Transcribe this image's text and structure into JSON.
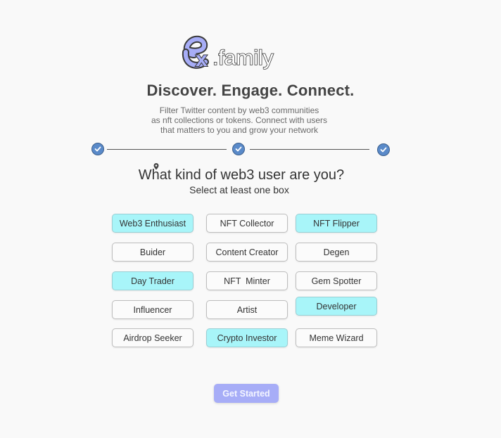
{
  "brand": {
    "logo_text_ex": "ex",
    "logo_text_family": ".family",
    "accent": "#a7adf7"
  },
  "hero": {
    "headline": "Discover. Engage. Connect.",
    "sub_line1": "Filter Twitter content by web3 communities",
    "sub_line2": "as nft collections or tokens. Connect with users",
    "sub_line3": "that matters to you and grow your network"
  },
  "steps": {
    "count": 3,
    "completed": 3,
    "icon": "check-icon",
    "color": "#5a8ac9"
  },
  "question": {
    "title": "What kind of web3 user are you?",
    "hint": "Select at least one box"
  },
  "options": [
    {
      "label": "Web3 Enthusiast",
      "selected": true
    },
    {
      "label": "NFT Collector",
      "selected": false
    },
    {
      "label": "NFT Flipper",
      "selected": true
    },
    {
      "label": "Buider",
      "selected": false
    },
    {
      "label": "Content Creator",
      "selected": false
    },
    {
      "label": "Degen",
      "selected": false
    },
    {
      "label": "Day Trader",
      "selected": true
    },
    {
      "label": "NFT  Minter",
      "selected": false
    },
    {
      "label": "Gem Spotter",
      "selected": false
    },
    {
      "label": "Influencer",
      "selected": false
    },
    {
      "label": "Artist",
      "selected": false
    },
    {
      "label": "Developer",
      "selected": true
    },
    {
      "label": "Airdrop Seeker",
      "selected": false
    },
    {
      "label": "Crypto Investor",
      "selected": true
    },
    {
      "label": "Meme Wizard",
      "selected": false
    }
  ],
  "cta": {
    "label": "Get Started"
  },
  "colors": {
    "selected_bg": "#a8f5f9",
    "button_bg": "#a7adf7"
  }
}
